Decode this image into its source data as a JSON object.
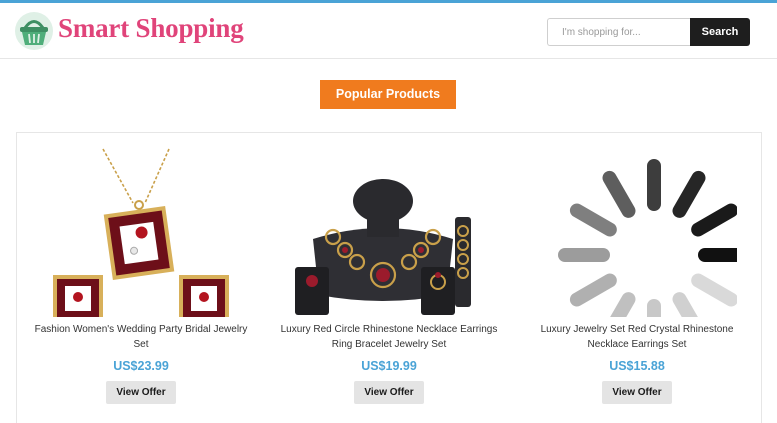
{
  "header": {
    "logo_icon": "shopping-basket-icon",
    "brand": "Smart Shopping",
    "search": {
      "placeholder": "I'm shopping for...",
      "value": "",
      "button_label": "Search"
    }
  },
  "colors": {
    "accent_top_line": "#4aa3d6",
    "brand": "#e0447a",
    "section_title_bg": "#f07b1e",
    "price": "#4aa3d6",
    "search_button_bg": "#1e1e1e",
    "offer_button_bg": "#e4e4e4"
  },
  "section_title": "Popular Products",
  "products": [
    {
      "title": "Fashion Women's Wedding Party Bridal Jewelry Set",
      "price": "US$23.99",
      "button_label": "View Offer",
      "image": "jewelry-set-photo"
    },
    {
      "title": "Luxury Red Circle Rhinestone Necklace Earrings Ring Bracelet Jewelry Set",
      "price": "US$19.99",
      "button_label": "View Offer",
      "image": "jewelry-display-photo"
    },
    {
      "title": "Luxury Jewelry Set Red Crystal Rhinestone Necklace Earrings Set",
      "price": "US$15.88",
      "button_label": "View Offer",
      "image": "loading-spinner-icon"
    }
  ]
}
